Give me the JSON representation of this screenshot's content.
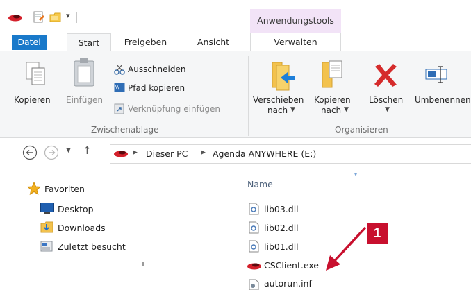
{
  "titlebar": {
    "contextual_tab_group": "Anwendungstools"
  },
  "tabs": {
    "file": "Datei",
    "start": "Start",
    "share": "Freigeben",
    "view": "Ansicht",
    "manage": "Verwalten"
  },
  "ribbon": {
    "clipboard": {
      "copy": "Kopieren",
      "paste": "Einfügen",
      "cut": "Ausschneiden",
      "copy_path": "Pfad kopieren",
      "paste_shortcut": "Verknüpfung einfügen",
      "group_label": "Zwischenablage"
    },
    "organize": {
      "move_to_line1": "Verschieben",
      "move_to_line2": "nach",
      "copy_to_line1": "Kopieren",
      "copy_to_line2": "nach",
      "delete": "Löschen",
      "rename": "Umbenennen",
      "group_label": "Organisieren"
    }
  },
  "address": {
    "crumbs": [
      "Dieser PC",
      "Agenda ANYWHERE (E:)"
    ]
  },
  "nav_pane": {
    "favorites": "Favoriten",
    "items": [
      "Desktop",
      "Downloads",
      "Zuletzt besucht"
    ]
  },
  "file_list": {
    "column_name": "Name",
    "files": [
      "lib03.dll",
      "lib02.dll",
      "lib01.dll",
      "CSClient.exe",
      "autorun.inf"
    ]
  },
  "annotation": {
    "badge": "1",
    "color": "#c8102e"
  }
}
